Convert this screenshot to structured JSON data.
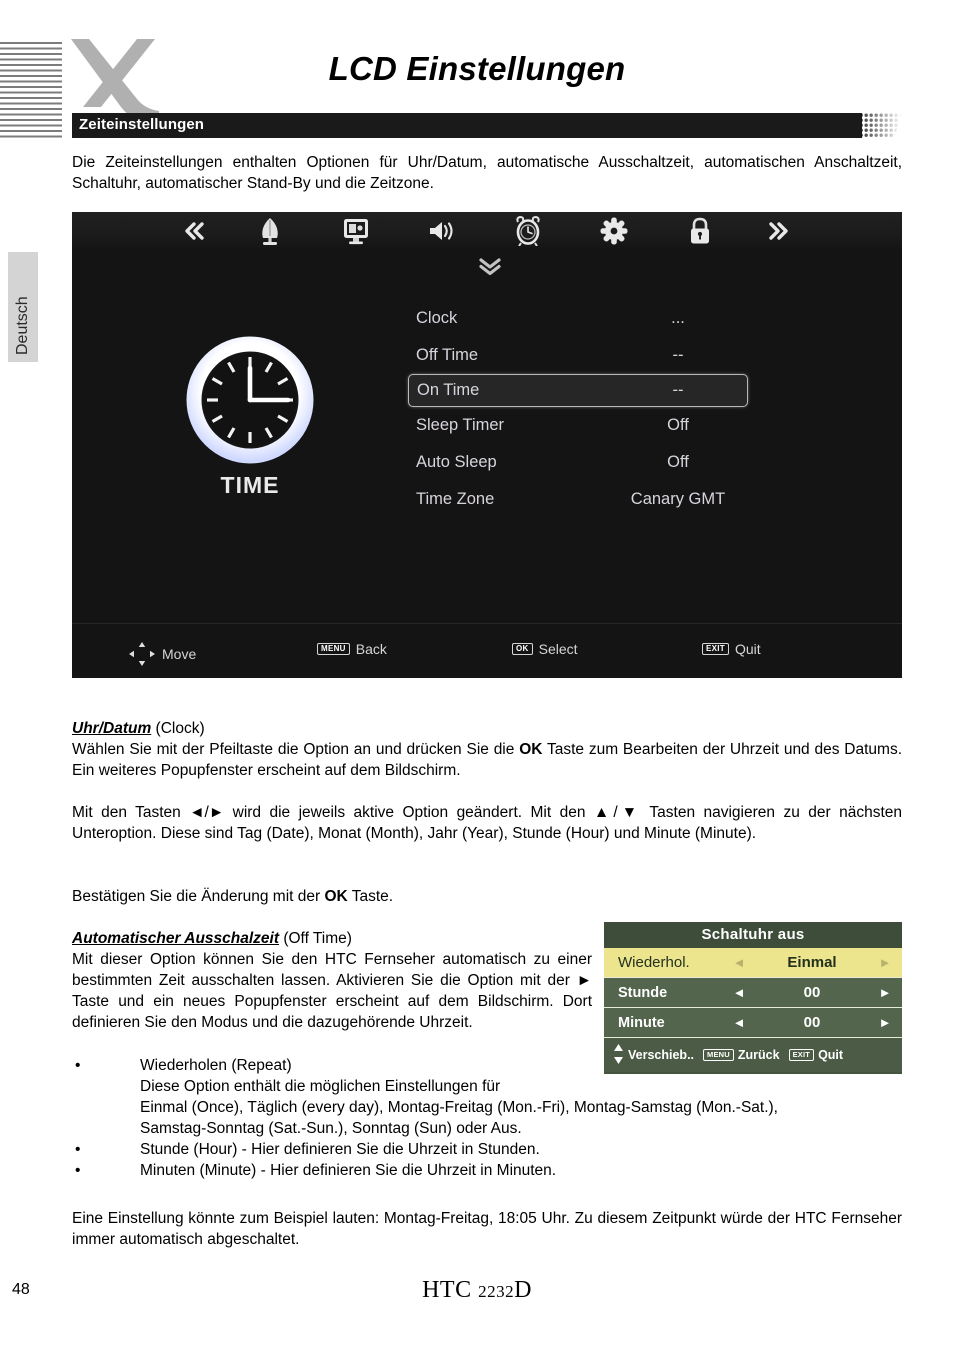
{
  "document": {
    "title": "LCD Einstellungen",
    "section_heading": "Zeiteinstellungen",
    "side_tab": "Deutsch",
    "intro": "Die Zeiteinstellungen enthalten Optionen für Uhr/Datum, automatische Ausschaltzeit, automatischen Anschaltzeit, Schaltuhr, automatischer Stand-By und die Zeitzone.",
    "page_number": "48",
    "footer_model_main": "HTC ",
    "footer_model_sub": "2232",
    "footer_model_tail": "D"
  },
  "tv_screen": {
    "toolbar_icons": [
      {
        "name": "prev-chevron-icon",
        "glyph": "«"
      },
      {
        "name": "antenna-icon",
        "glyph": ""
      },
      {
        "name": "picture-monitor-icon",
        "glyph": ""
      },
      {
        "name": "speaker-volume-icon",
        "glyph": ""
      },
      {
        "name": "alarm-clock-icon",
        "glyph": ""
      },
      {
        "name": "gear-settings-icon",
        "glyph": ""
      },
      {
        "name": "lock-icon",
        "glyph": ""
      },
      {
        "name": "next-chevron-icon",
        "glyph": "»"
      }
    ],
    "clock_graphic_label": "TIME",
    "menu": [
      {
        "label": "Clock",
        "value": "...",
        "selected": false
      },
      {
        "label": "Off Time",
        "value": "--",
        "selected": false
      },
      {
        "label": "On Time",
        "value": "--",
        "selected": true
      },
      {
        "label": "Sleep Timer",
        "value": "Off",
        "selected": false
      },
      {
        "label": "Auto Sleep",
        "value": "Off",
        "selected": false
      },
      {
        "label": "Time Zone",
        "value": "Canary GMT",
        "selected": false
      }
    ],
    "hints": [
      {
        "key": "",
        "label": "Move"
      },
      {
        "key": "MENU",
        "label": "Back"
      },
      {
        "key": "OK",
        "label": "Select"
      },
      {
        "key": "EXIT",
        "label": "Quit"
      }
    ]
  },
  "section_clock": {
    "heading_bold": "Uhr/Datum",
    "heading_rest": " (Clock)",
    "p1_a": "Wählen Sie mit der Pfeiltaste die Option an und drücken Sie die ",
    "p1_b": "OK",
    "p1_c": " Taste zum Bearbeiten der Uhrzeit und des Datums. Ein weiteres Popupfenster erscheint auf dem Bildschirm.",
    "p2": "Mit den Tasten ◄/► wird die jeweils aktive Option geändert. Mit den ▲/▼ Tasten navigieren zu der nächsten Unteroption. Diese sind Tag (Date), Monat (Month), Jahr (Year), Stunde (Hour) und Minute (Minute).",
    "p3_a": "Bestätigen Sie die Änderung mit der ",
    "p3_b": "OK",
    "p3_c": " Taste."
  },
  "section_offtime": {
    "heading_bold": "Automatischer Ausschalzeit",
    "heading_rest": " (Off Time)",
    "paragraph": "Mit dieser Option können Sie den HTC Fernseher automatisch zu einer bestimmten Zeit ausschalten lassen. Aktivieren Sie die Option mit der ► Taste und ein neues Popupfenster erscheint auf dem Bildschirm. Dort definieren Sie den Modus und die dazugehörende Uhrzeit.",
    "bullets": [
      {
        "dot": "•",
        "lines": [
          "Wiederholen (Repeat)",
          "Diese Option enthält die möglichen Einstellungen für",
          "Einmal (Once), Täglich (every day), Montag-Freitag (Mon.-Fri), Montag-Samstag (Mon.-Sat.),",
          "Samstag-Sonntag (Sat.-Sun.), Sonntag (Sun) oder Aus."
        ]
      },
      {
        "dot": "•",
        "lines": [
          "Stunde (Hour) - Hier definieren Sie die Uhrzeit in Stunden."
        ]
      },
      {
        "dot": "•",
        "lines": [
          "Minuten (Minute) - Hier definieren Sie die Uhrzeit in Minuten."
        ]
      }
    ],
    "closing": "Eine Einstellung könnte zum Beispiel lauten: Montag-Freitag, 18:05 Uhr. Zu diesem Zeitpunkt würde der HTC Fernseher immer automatisch abgeschaltet."
  },
  "osd_popup": {
    "title": "Schaltuhr aus",
    "rows": [
      {
        "label": "Wiederhol.",
        "value": "Einmal",
        "left_arrow": "◄",
        "right_arrow": "►",
        "highlighted": true
      },
      {
        "label": "Stunde",
        "value": "00",
        "left_arrow": "◄",
        "right_arrow": "►",
        "highlighted": false
      },
      {
        "label": "Minute",
        "value": "00",
        "left_arrow": "◄",
        "right_arrow": "►",
        "highlighted": false
      }
    ],
    "footer": [
      {
        "key": "",
        "label": "Verschieb.."
      },
      {
        "key": "MENU",
        "label": "Zurück"
      },
      {
        "key": "EXIT",
        "label": "Quit"
      }
    ]
  },
  "colors": {
    "section_bar": "#1a1a1a",
    "tv_background": "#141414",
    "osd_highlight": "#ece58e",
    "osd_row": "#53654c",
    "osd_title": "#3e4d39",
    "logo_gray": "#b0b0b0"
  }
}
